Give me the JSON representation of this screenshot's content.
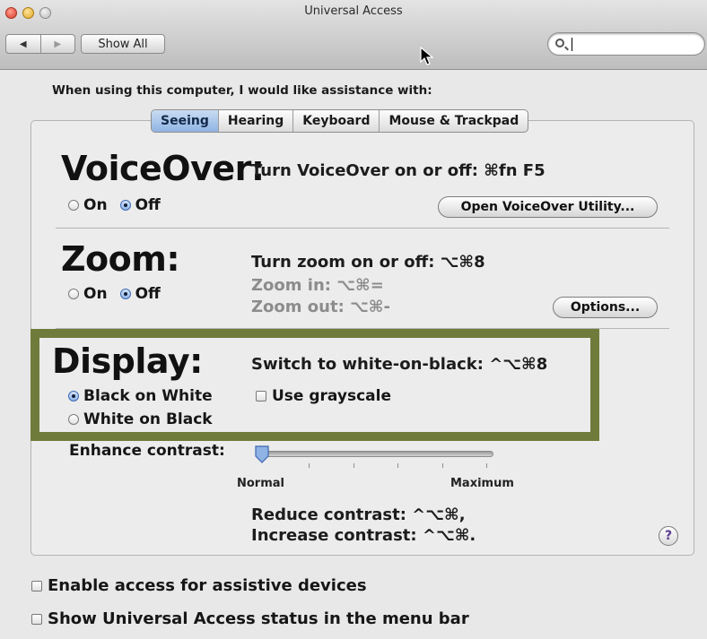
{
  "window": {
    "title": "Universal Access",
    "show_all": "Show All",
    "search_value": ""
  },
  "intro": "When using this computer, I would like assistance with:",
  "tabs": [
    {
      "label": "Seeing",
      "selected": true
    },
    {
      "label": "Hearing",
      "selected": false
    },
    {
      "label": "Keyboard",
      "selected": false
    },
    {
      "label": "Mouse & Trackpad",
      "selected": false
    }
  ],
  "voiceover": {
    "heading": "VoiceOver:",
    "shortcut": "Turn VoiceOver on or off: ⌘fn F5",
    "on_label": "On",
    "off_label": "Off",
    "selected": "Off",
    "utility_button": "Open VoiceOver Utility..."
  },
  "zoom": {
    "heading": "Zoom:",
    "shortcut": "Turn zoom on or off: ⌥⌘8",
    "zoom_in": "Zoom in: ⌥⌘=",
    "zoom_out": "Zoom out: ⌥⌘-",
    "on_label": "On",
    "off_label": "Off",
    "selected": "Off",
    "options_button": "Options..."
  },
  "display": {
    "heading": "Display:",
    "shortcut": "Switch to white-on-black: ^⌥⌘8",
    "black_on_white": "Black on White",
    "white_on_black": "White on Black",
    "selected": "Black on White",
    "grayscale_label": "Use grayscale",
    "grayscale_checked": false,
    "highlight_color": "#6f7b3a"
  },
  "contrast": {
    "label": "Enhance contrast:",
    "min_label": "Normal",
    "max_label": "Maximum",
    "level": 0,
    "reduce": "Reduce contrast: ^⌥⌘,",
    "increase": "Increase contrast: ^⌥⌘."
  },
  "help_label": "?",
  "bottom": {
    "assistive": "Enable access for assistive devices",
    "assistive_checked": false,
    "status_menu": "Show Universal Access status in the menu bar",
    "status_menu_checked": false
  },
  "colors": {
    "tab_selected": "#8fb4e3",
    "highlight": "#6f7b3a"
  }
}
